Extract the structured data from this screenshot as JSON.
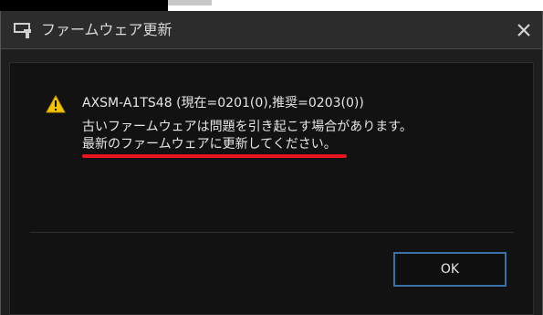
{
  "window": {
    "title": "ファームウェア更新",
    "close_symbol": "×",
    "icons": {
      "app": "firmware-tool-icon",
      "close": "close-icon"
    }
  },
  "message": {
    "icon": "warning-icon",
    "device_line": "AXSM-A1TS48 (現在=0201(0),推奨=0203(0))",
    "warning_line1": "古いファームウェアは問題を引き起こす場合があります。",
    "warning_line2": "最新のファームウェアに更新してください。",
    "highlight_color": "#e8141e"
  },
  "buttons": {
    "ok_label": "OK"
  },
  "colors": {
    "background": "#1e1e1e",
    "text": "#e6e6e6",
    "button_border": "#3a6fa8",
    "warning_yellow": "#f5c400"
  }
}
